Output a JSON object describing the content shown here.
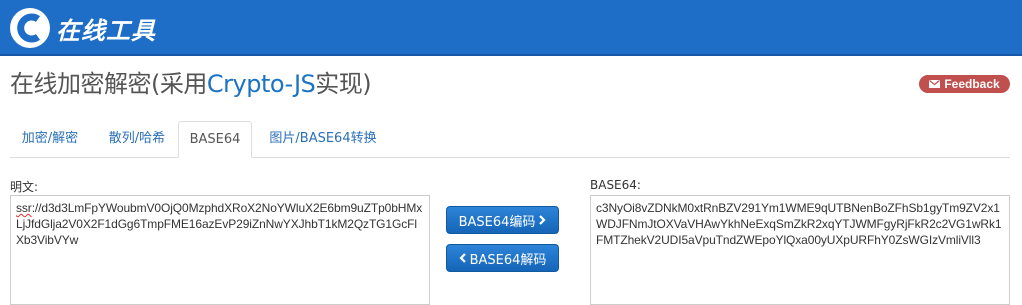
{
  "header": {
    "logo_text": "在线工具",
    "logo_icon": "c-logo-icon"
  },
  "title": {
    "prefix": "在线加密解密(采用",
    "accent": "Crypto-JS",
    "suffix": "实现)"
  },
  "feedback": {
    "label": "Feedback",
    "icon": "envelope-icon",
    "color": "#c0504d"
  },
  "tabs": [
    {
      "label": "加密/解密",
      "active": false
    },
    {
      "label": "散列/哈希",
      "active": false
    },
    {
      "label": "BASE64",
      "active": true
    },
    {
      "label": "图片/BASE64转换",
      "active": false
    }
  ],
  "plain": {
    "label": "明文:",
    "value_head": "ssr",
    "value_tail": "://d3d3LmFpYWoubmV0OjQ0MzphdXRoX2NoYWluX2E6bm9uZTp0bHMxLjJfdGlja2V0X2F1dGg6TmpFME16azEvP29iZnNwYXJhbT1kM2QzTG1GcFlXb3VibVYw"
  },
  "encoded": {
    "label": "BASE64:",
    "value": "c3NyOi8vZDNkM0xtRnBZV291Ym1WME9qUTBNenBoZFhSb1gyTm9ZV2x1WDJFNmJtOXVaVHAwYkhNeExqSmZkR2xqYTJWMFgyRjFkR2c2VG1wRk1FMTZhekV2UDI5aVpuTndZWEpoYlQxa00yUXpURFhY0ZsWGIzVmliVll3"
  },
  "buttons": {
    "encode_label": "BASE64编码",
    "encode_icon": "chevron-right-icon",
    "decode_label": "BASE64解码",
    "decode_icon": "chevron-left-icon"
  },
  "colors": {
    "header_bg": "#1e6ec8",
    "accent": "#1a73c4",
    "button": "#1565b8"
  }
}
